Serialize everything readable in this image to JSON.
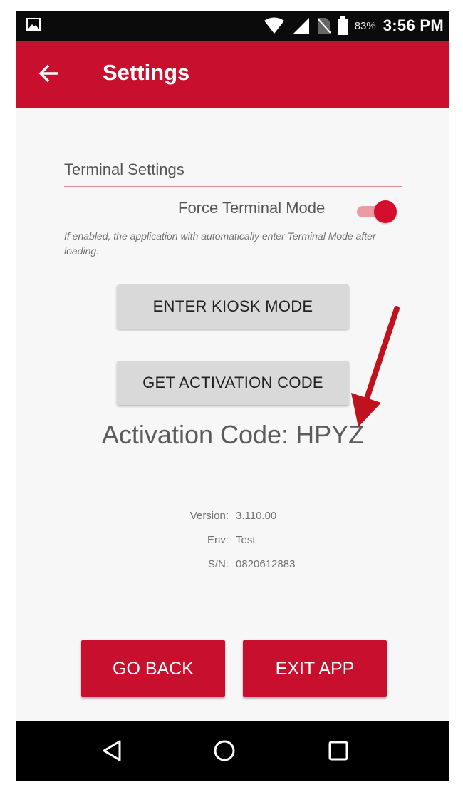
{
  "status_bar": {
    "battery_percent": "83%",
    "time": "3:56 PM",
    "icons": [
      "image-notification-icon",
      "wifi-icon",
      "signal-icon",
      "no-sim-icon",
      "battery-icon"
    ]
  },
  "app_bar": {
    "title": "Settings",
    "back_icon": "arrow-left-icon",
    "color": "#c8102e"
  },
  "terminal": {
    "section_title": "Terminal Settings",
    "force_mode_label": "Force Terminal Mode",
    "force_mode_enabled": true,
    "hint": "If enabled, the application with automatically enter Terminal Mode after loading."
  },
  "buttons": {
    "kiosk": "ENTER KIOSK MODE",
    "activation": "GET ACTIVATION CODE",
    "go_back": "GO BACK",
    "exit": "EXIT APP"
  },
  "activation": {
    "text": "Activation Code: HPYZ"
  },
  "info": {
    "version_label": "Version:",
    "version_value": "3.110.00",
    "env_label": "Env:",
    "env_value": "Test",
    "sn_label": "S/N:",
    "sn_value": "0820612883"
  },
  "nav_bar": {
    "icons": [
      "nav-back-icon",
      "nav-home-icon",
      "nav-recent-icon"
    ]
  },
  "annotation": {
    "arrow_color": "#c0111f"
  }
}
